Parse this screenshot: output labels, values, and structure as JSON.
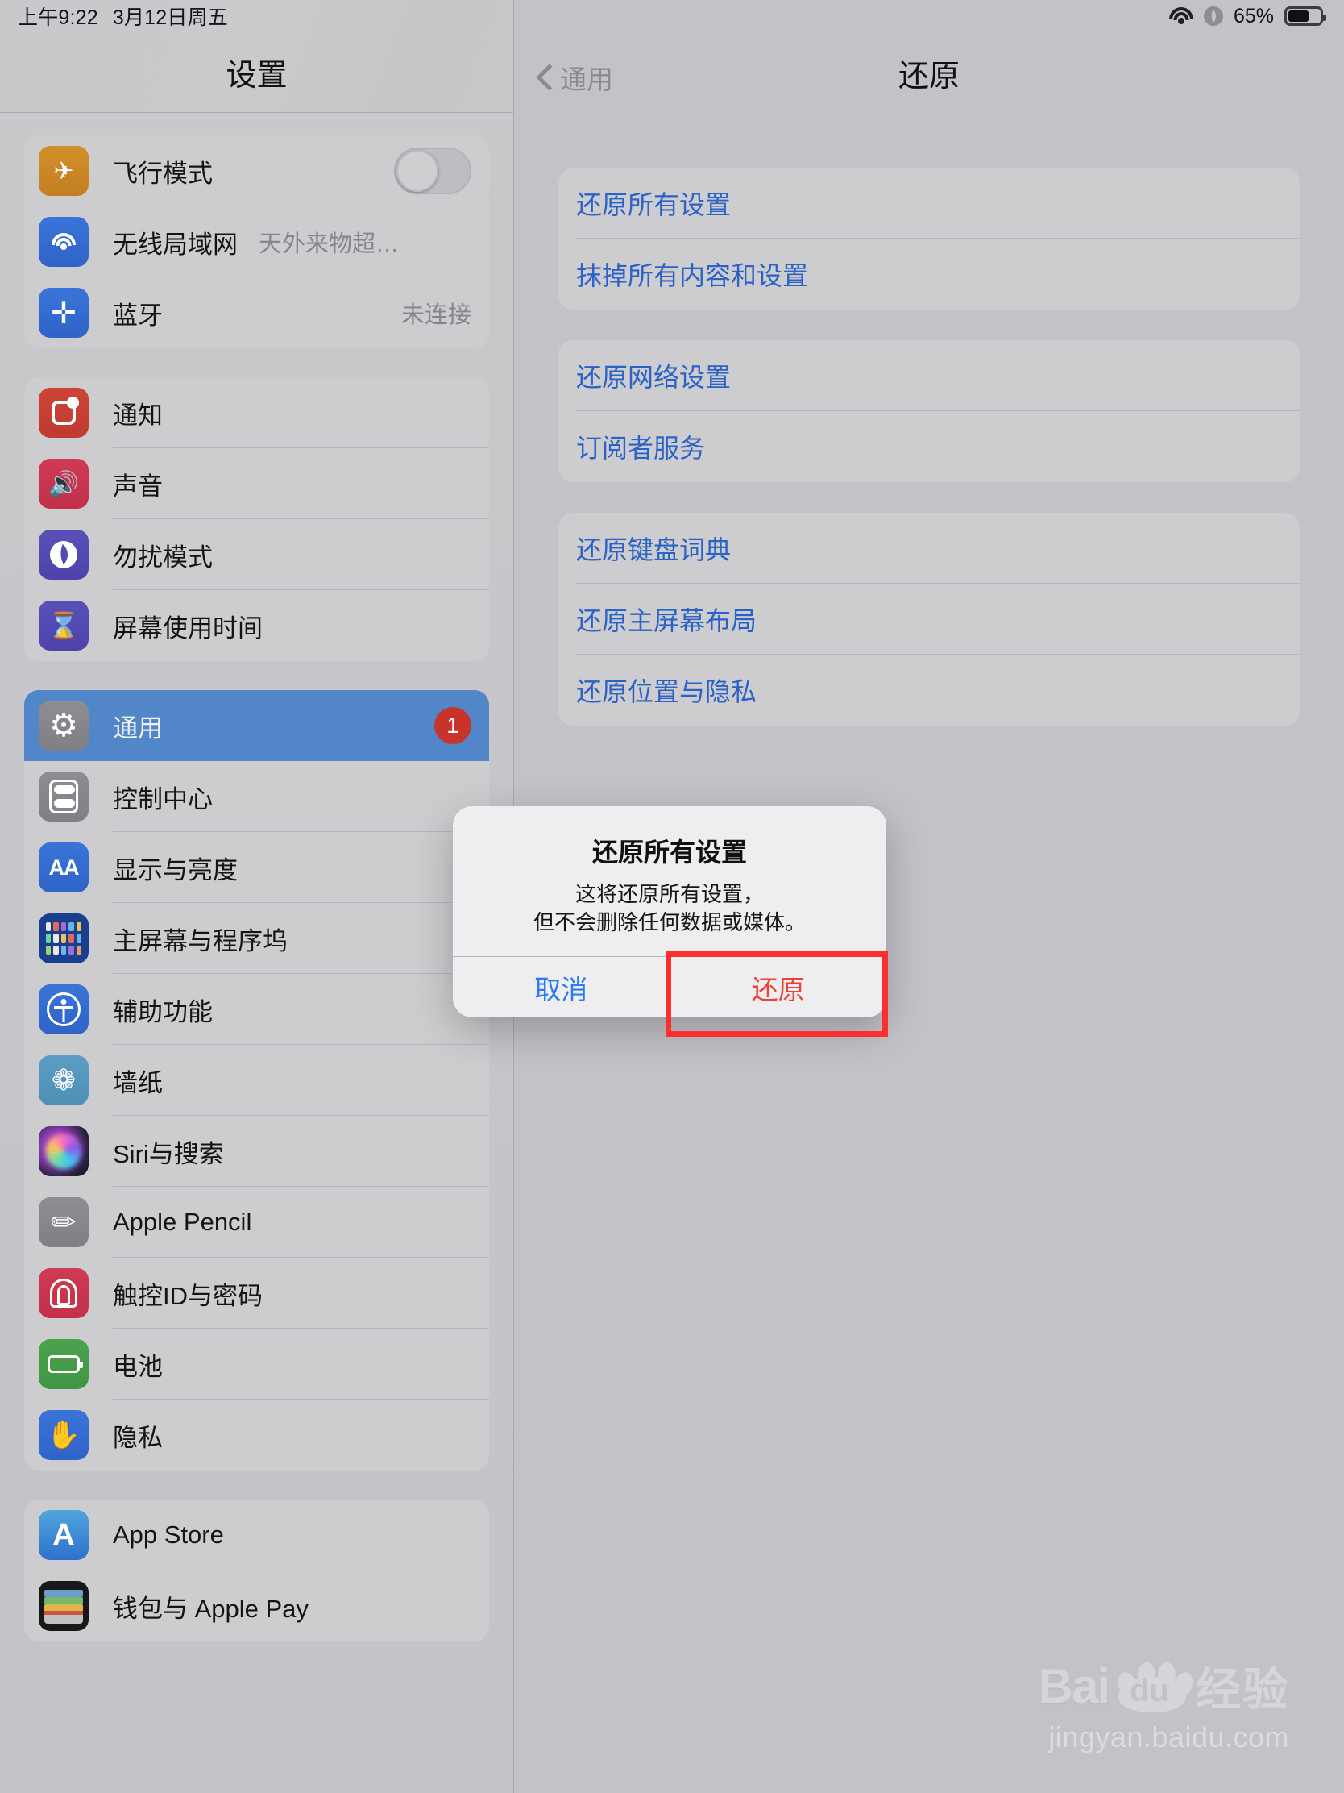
{
  "status_bar": {
    "time": "上午9:22",
    "date": "3月12日周五",
    "wifi_icon": "wifi-icon",
    "dnd_icon": "moon-icon",
    "battery_percent": "65%",
    "battery_icon": "battery-icon"
  },
  "sidebar": {
    "title": "设置",
    "groups": [
      {
        "items": [
          {
            "label": "飞行模式",
            "icon": "airplane-icon",
            "icon_class": "ic-plane",
            "glyph": "✈",
            "control": "toggle",
            "toggle_on": false
          },
          {
            "label": "无线局域网",
            "icon": "wifi-icon",
            "icon_class": "ic-wifi",
            "glyph": "",
            "value": "天外来物超…"
          },
          {
            "label": "蓝牙",
            "icon": "bluetooth-icon",
            "icon_class": "ic-bt",
            "glyph": "✛",
            "value": "未连接"
          }
        ]
      },
      {
        "items": [
          {
            "label": "通知",
            "icon": "notifications-icon",
            "icon_class": "ic-notif",
            "glyph": ""
          },
          {
            "label": "声音",
            "icon": "sound-icon",
            "icon_class": "ic-sound",
            "glyph": "🔊"
          },
          {
            "label": "勿扰模式",
            "icon": "moon-icon",
            "icon_class": "ic-dnd",
            "glyph": ""
          },
          {
            "label": "屏幕使用时间",
            "icon": "hourglass-icon",
            "icon_class": "ic-screen",
            "glyph": "⌛"
          }
        ]
      },
      {
        "items": [
          {
            "label": "通用",
            "icon": "gear-icon",
            "icon_class": "ic-gear",
            "glyph": "⚙",
            "selected": true,
            "badge": "1"
          },
          {
            "label": "控制中心",
            "icon": "control-center-icon",
            "icon_class": "ic-cc",
            "glyph": ""
          },
          {
            "label": "显示与亮度",
            "icon": "display-icon",
            "icon_class": "ic-aa",
            "glyph": "AA"
          },
          {
            "label": "主屏幕与程序坞",
            "icon": "home-screen-icon",
            "icon_class": "ic-home",
            "glyph": ""
          },
          {
            "label": "辅助功能",
            "icon": "accessibility-icon",
            "icon_class": "ic-acc",
            "glyph": ""
          },
          {
            "label": "墙纸",
            "icon": "wallpaper-icon",
            "icon_class": "ic-wall",
            "glyph": "❀"
          },
          {
            "label": "Siri与搜索",
            "icon": "siri-icon",
            "icon_class": "ic-siri",
            "glyph": ""
          },
          {
            "label": "Apple Pencil",
            "icon": "pencil-icon",
            "icon_class": "ic-pencil",
            "glyph": "✎"
          },
          {
            "label": "触控ID与密码",
            "icon": "fingerprint-icon",
            "icon_class": "ic-touch",
            "glyph": ""
          },
          {
            "label": "电池",
            "icon": "battery-icon",
            "icon_class": "ic-batt",
            "glyph": ""
          },
          {
            "label": "隐私",
            "icon": "privacy-hand-icon",
            "icon_class": "ic-priv",
            "glyph": "✋"
          }
        ]
      },
      {
        "items": [
          {
            "label": "App Store",
            "icon": "app-store-icon",
            "icon_class": "ic-store",
            "glyph": "A"
          },
          {
            "label": "钱包与 Apple Pay",
            "icon": "wallet-icon",
            "icon_class": "ic-wallet",
            "glyph": ""
          }
        ]
      }
    ]
  },
  "detail": {
    "back_label": "通用",
    "title": "还原",
    "groups": [
      {
        "items": [
          "还原所有设置",
          "抹掉所有内容和设置"
        ]
      },
      {
        "items": [
          "还原网络设置",
          "订阅者服务"
        ]
      },
      {
        "items": [
          "还原键盘词典",
          "还原主屏幕布局",
          "还原位置与隐私"
        ]
      }
    ]
  },
  "alert": {
    "title": "还原所有设置",
    "message_line1": "这将还原所有设置，",
    "message_line2": "但不会删除任何数据或媒体。",
    "cancel_label": "取消",
    "confirm_label": "还原",
    "confirm_color": "#ef4034",
    "cancel_color": "#2b7bf0",
    "highlight_color": "#fc2e2e"
  },
  "watermark": {
    "bai": "Bai",
    "du": "du",
    "jingyan": "经验",
    "url": "jingyan.baidu.com"
  },
  "colors": {
    "accent_blue": "#2b62c6",
    "selected_row": "#5186c8",
    "badge_red": "#c9342a",
    "background": "#c2c2c7"
  }
}
